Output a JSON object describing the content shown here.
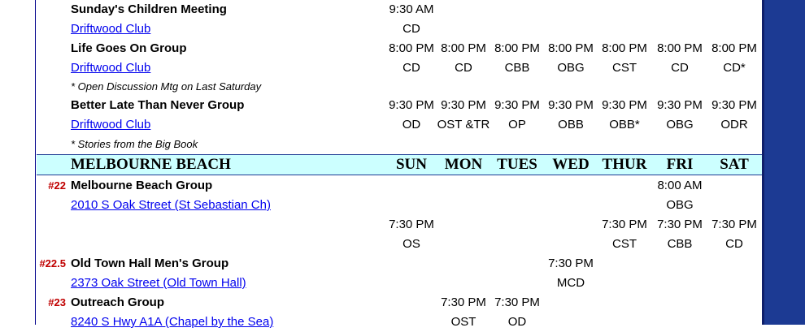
{
  "groups_top": [
    {
      "name": "Sunday's Children Meeting",
      "link": "Driftwood Club",
      "times": [
        "9:30 AM",
        "",
        "",
        "",
        "",
        "",
        ""
      ],
      "codes": [
        "CD",
        "",
        "",
        "",
        "",
        "",
        ""
      ]
    },
    {
      "name": "Life Goes On Group",
      "link": "Driftwood Club",
      "times": [
        "8:00 PM",
        "8:00 PM",
        "8:00 PM",
        "8:00 PM",
        "8:00 PM",
        "8:00 PM",
        "8:00 PM"
      ],
      "codes": [
        "CD",
        "CD",
        "CBB",
        "OBG",
        "CST",
        "CD",
        "CD*"
      ],
      "note": "* Open Discussion Mtg on Last Saturday"
    },
    {
      "name": "Better Late Than Never Group",
      "link": "Driftwood Club",
      "times": [
        "9:30 PM",
        "9:30 PM",
        "9:30 PM",
        "9:30 PM",
        "9:30 PM",
        "9:30 PM",
        "9:30 PM"
      ],
      "codes": [
        "OD",
        "OST &TR",
        "OP",
        "OBB",
        "OBB*",
        "OBG",
        "ODR"
      ],
      "note": "* Stories from the Big Book"
    }
  ],
  "section": {
    "title": "MELBOURNE BEACH",
    "days": [
      "SUN",
      "MON",
      "TUES",
      "WED",
      "THUR",
      "FRI",
      "SAT"
    ]
  },
  "groups_bottom": [
    {
      "num": "#22",
      "name": "Melbourne Beach Group",
      "link": "2010 S Oak Street (St Sebastian Ch)",
      "sessions": [
        {
          "times": [
            "",
            "",
            "",
            "",
            "",
            "8:00 AM",
            ""
          ],
          "codes": [
            "",
            "",
            "",
            "",
            "",
            "OBG",
            ""
          ]
        },
        {
          "times": [
            "7:30 PM",
            "",
            "",
            "",
            "7:30 PM",
            "7:30 PM",
            "7:30 PM"
          ],
          "codes": [
            "OS",
            "",
            "",
            "",
            "CST",
            "CBB",
            "CD"
          ]
        }
      ]
    },
    {
      "num": "#22.5",
      "name": "Old Town Hall Men's Group",
      "link": "2373 Oak Street (Old Town Hall)",
      "sessions": [
        {
          "times": [
            "",
            "",
            "",
            "7:30 PM",
            "",
            "",
            ""
          ],
          "codes": [
            "",
            "",
            "",
            "MCD",
            "",
            "",
            ""
          ]
        }
      ]
    },
    {
      "num": "#23",
      "name": "Outreach Group",
      "link": "8240 S Hwy A1A (Chapel by the Sea)",
      "sessions": [
        {
          "times": [
            "",
            "7:30 PM",
            "7:30 PM",
            "",
            "",
            "",
            ""
          ],
          "codes": [
            "",
            "OST",
            "OD",
            "",
            "",
            "",
            ""
          ]
        }
      ]
    }
  ]
}
